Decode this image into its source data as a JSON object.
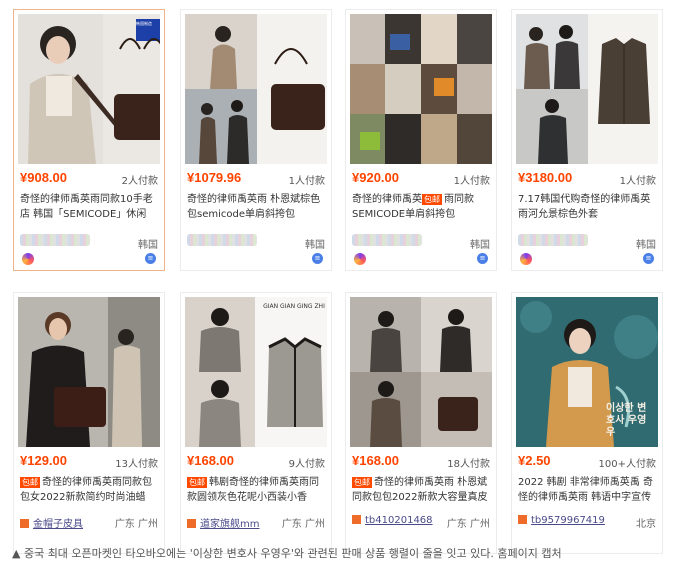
{
  "cards": [
    {
      "price": "¥908.00",
      "sold": "2人付款",
      "title_a": "奇怪的律师禹英",
      "title_b": "雨同款10手老店 韩国「SEMICODE」休闲",
      "region": "韩国",
      "logo_text": "韩国制造",
      "tag": ""
    },
    {
      "price": "¥1079.96",
      "sold": "1人付款",
      "title_a": "奇怪的律师禹英",
      "title_b": "雨 朴恩斌棕色包semicode单肩斜挎包",
      "region": "韩国",
      "tag": ""
    },
    {
      "price": "¥920.00",
      "sold": "1人付款",
      "title_a": "奇怪的律师禹英",
      "title_b": "雨同款SEMICODE单肩斜挎包",
      "region": "韩国",
      "tag": "包邮"
    },
    {
      "price": "¥3180.00",
      "sold": "1人付款",
      "title_a": "7.17韩国代购奇怪的律师禹英",
      "title_b": "雨河允景棕色外套",
      "region": "韩国",
      "tag": ""
    },
    {
      "price": "¥129.00",
      "sold": "13人付款",
      "title_a": "奇怪的律师禹英",
      "title_b": "雨同款包包女2022新款简约时尚油蜡",
      "shop": "金帽子皮具",
      "region": "广东 广州",
      "tag": "包邮"
    },
    {
      "price": "¥168.00",
      "sold": "9人付款",
      "title_a": "韩剧奇怪的律师禹英",
      "title_b": "雨同款圆领灰色花呢小西装小香",
      "shop": "道家旗舰mm",
      "region": "广东 广州",
      "tag": "包邮",
      "logo_text": "GIAN GIAN GING ZHI"
    },
    {
      "price": "¥168.00",
      "sold": "18人付款",
      "title_a": "奇怪的律师禹英",
      "title_b": "雨 朴恩斌同款包包2022新款大容量真皮",
      "shop": "tb410201468",
      "region": "广东 广州",
      "tag": "包邮"
    },
    {
      "price": "¥2.50",
      "sold": "100+人付款",
      "title_a": "2022 韩剧 非常律师禹英",
      "title_b": "禹 奇怪的律师禹英雨 韩语中字宣传",
      "shop": "tb9579967419",
      "region": "北京",
      "tag": "",
      "poster_text": "이상한 변호사 우영우"
    }
  ],
  "caption": "▲ 중국 최대 오픈마켓인 타오바오에는 '이상한 변호사 우영우'와 관련된 판매 상품 행렬이 줄을 잇고 있다. 홈페이지 캡처",
  "colors": {
    "price": "#ff4400",
    "accent": "#ff4a00",
    "highlight_border": "#f0b48a"
  }
}
